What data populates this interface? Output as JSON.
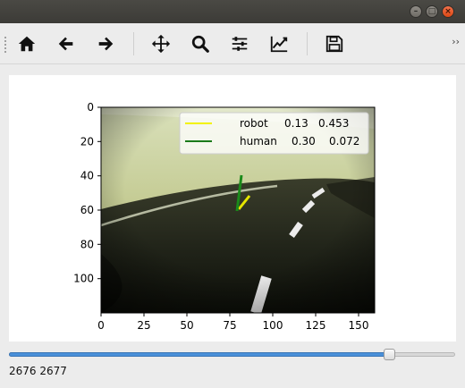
{
  "window": {
    "buttons": [
      "minimize",
      "maximize",
      "close"
    ]
  },
  "toolbar": {
    "items": [
      {
        "name": "home-icon"
      },
      {
        "name": "back-arrow-icon"
      },
      {
        "name": "forward-arrow-icon"
      },
      {
        "name": "pan-icon"
      },
      {
        "name": "zoom-icon"
      },
      {
        "name": "configure-subplots-icon"
      },
      {
        "name": "edit-axis-icon"
      },
      {
        "name": "save-icon"
      }
    ],
    "overflow_label": "››"
  },
  "plot": {
    "x_ticks": [
      "0",
      "25",
      "50",
      "75",
      "100",
      "125",
      "150"
    ],
    "y_ticks": [
      "0",
      "20",
      "40",
      "60",
      "80",
      "100"
    ],
    "legend": [
      {
        "label": "robot",
        "v1": "0.13",
        "v2": "0.453",
        "color": "#f2f200"
      },
      {
        "label": "human",
        "v1": "0.30",
        "v2": "0.072",
        "color": "#1a7a1a"
      }
    ]
  },
  "slider": {
    "fraction": 0.852
  },
  "status": {
    "text": "2676 2677"
  }
}
